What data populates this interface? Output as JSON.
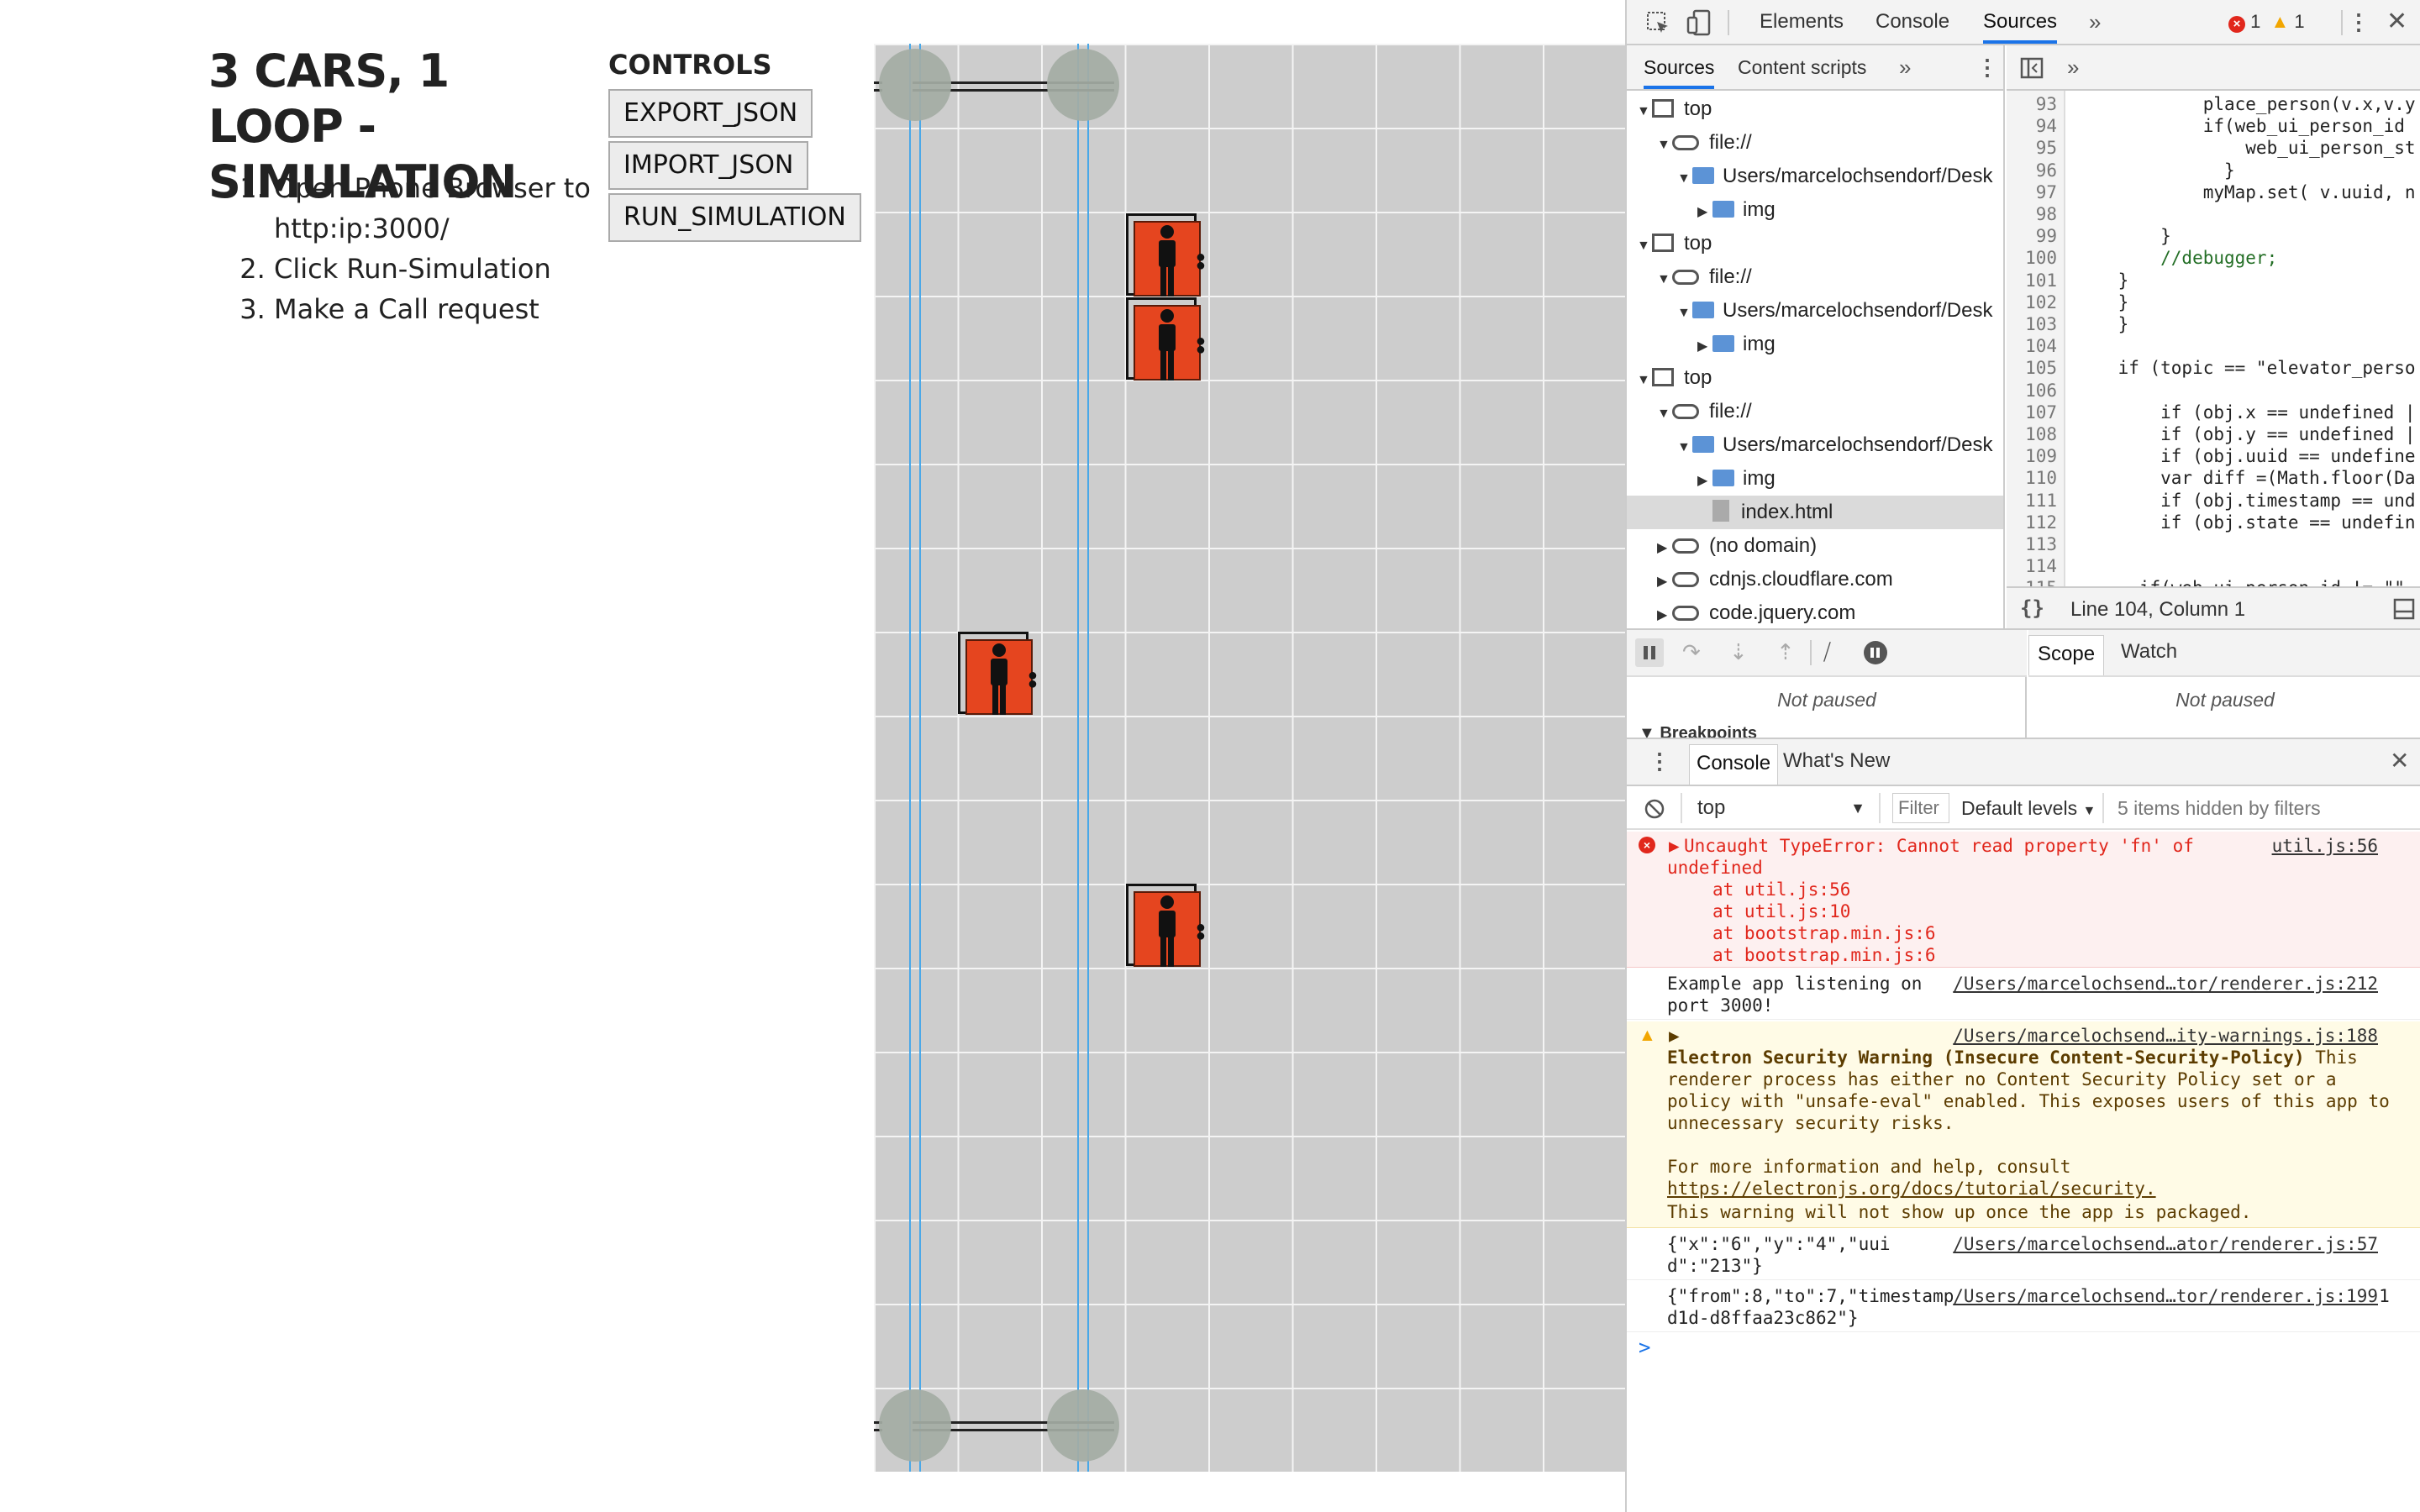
{
  "app": {
    "title": "3 CARS, 1 LOOP - SIMULATION",
    "steps": [
      "Open Phone Browser to http:ip:3000/",
      "Click Run-Simulation",
      "Make a Call request"
    ],
    "controls_title": "CONTROLS",
    "buttons": {
      "export": "EXPORT_JSON",
      "import": "IMPORT_JSON",
      "run": "RUN_SIMULATION"
    }
  },
  "devtools": {
    "tabs": [
      "Elements",
      "Console",
      "Sources"
    ],
    "active_tab": "Sources",
    "error_count": "1",
    "warning_count": "1",
    "navigator": {
      "tabs": [
        "Sources",
        "Content scripts"
      ],
      "tree": [
        {
          "type": "frame",
          "label": "top"
        },
        {
          "type": "cloud",
          "label": "file://"
        },
        {
          "type": "folder",
          "label": "Users/marcelochsendorf/Desk"
        },
        {
          "type": "folder",
          "label": "img"
        },
        {
          "type": "frame",
          "label": "top"
        },
        {
          "type": "cloud",
          "label": "file://"
        },
        {
          "type": "folder",
          "label": "Users/marcelochsendorf/Desk"
        },
        {
          "type": "folder",
          "label": "img"
        },
        {
          "type": "frame",
          "label": "top"
        },
        {
          "type": "cloud",
          "label": "file://"
        },
        {
          "type": "folder",
          "label": "Users/marcelochsendorf/Desk"
        },
        {
          "type": "folder",
          "label": "img"
        },
        {
          "type": "file",
          "label": "index.html"
        },
        {
          "type": "cloud",
          "label": "(no domain)"
        },
        {
          "type": "cloud",
          "label": "cdnjs.cloudflare.com"
        },
        {
          "type": "cloud",
          "label": "code.jquery.com"
        }
      ]
    },
    "code": {
      "lines": [
        {
          "n": "93",
          "text": "            place_person(v.x,v.y"
        },
        {
          "n": "94",
          "text": "            if(web_ui_person_id "
        },
        {
          "n": "95",
          "text": "                web_ui_person_st"
        },
        {
          "n": "96",
          "text": "              }"
        },
        {
          "n": "97",
          "text": "            myMap.set( v.uuid, n"
        },
        {
          "n": "98",
          "text": ""
        },
        {
          "n": "99",
          "text": "        }"
        },
        {
          "n": "100",
          "text": "        //debugger;"
        },
        {
          "n": "101",
          "text": "    }"
        },
        {
          "n": "102",
          "text": "    }"
        },
        {
          "n": "103",
          "text": "    }"
        },
        {
          "n": "104",
          "text": ""
        },
        {
          "n": "105",
          "text": "    if (topic == \"elevator_perso"
        },
        {
          "n": "106",
          "text": ""
        },
        {
          "n": "107",
          "text": "        if (obj.x == undefined |"
        },
        {
          "n": "108",
          "text": "        if (obj.y == undefined |"
        },
        {
          "n": "109",
          "text": "        if (obj.uuid == undefine"
        },
        {
          "n": "110",
          "text": "        var diff =(Math.floor(Da"
        },
        {
          "n": "111",
          "text": "        if (obj.timestamp == und"
        },
        {
          "n": "112",
          "text": "        if (obj.state == undefin"
        },
        {
          "n": "113",
          "text": ""
        },
        {
          "n": "114",
          "text": ""
        },
        {
          "n": "115",
          "text": "      if(web_ui_person_id != \"\""
        }
      ],
      "status": "Line 104, Column 1"
    },
    "debugger": {
      "left_status": "Not paused",
      "right_tabs": [
        "Scope",
        "Watch"
      ],
      "right_status": "Not paused",
      "breakpoints_label": "Breakpoints"
    },
    "console": {
      "tabs": [
        "Console",
        "What's New"
      ],
      "context": "top",
      "filter_placeholder": "Filter",
      "levels": "Default levels",
      "hidden_info": "5 items hidden by filters",
      "messages": [
        {
          "kind": "error",
          "text": "Uncaught TypeError: Cannot read property 'fn' of undefined",
          "src": "util.js:56",
          "stack": [
            "at util.js:56",
            "at util.js:10",
            "at bootstrap.min.js:6",
            "at bootstrap.min.js:6"
          ]
        },
        {
          "kind": "log",
          "text": "Example app listening on port 3000!",
          "src": "/Users/marcelochsend…tor/renderer.js:212"
        },
        {
          "kind": "warn",
          "title": "Electron Security Warning (Insecure Content-Security-Policy)",
          "src": "/Users/marcelochsend…ity-warnings.js:188",
          "text": "This renderer process has either no Content Security Policy set or a policy with \"unsafe-eval\" enabled. This exposes users of this app to unnecessary security risks.",
          "more": "For more information and help, consult",
          "link": "https://electronjs.org/docs/tutorial/security.",
          "note": "This warning will not show up once the app is packaged."
        },
        {
          "kind": "log",
          "text": "{\"x\":\"6\",\"y\":\"4\",\"uuid\":\"213\"}",
          "src": "/Users/marcelochsend…ator/renderer.js:57"
        },
        {
          "kind": "log",
          "text": "{\"from\":8,\"to\":7,\"timestamp\":1531302398,\"uuid\":\"16dae96d-6c4f-00d0-1d1d-d8ffaa23c862\"}",
          "src": "/Users/marcelochsend…tor/renderer.js:199"
        }
      ],
      "prompt": ">"
    }
  },
  "colors": {
    "accent": "#1a73e8",
    "rail": "#4aa8e8",
    "car_door": "#e5451f",
    "error": "#e1271c"
  }
}
